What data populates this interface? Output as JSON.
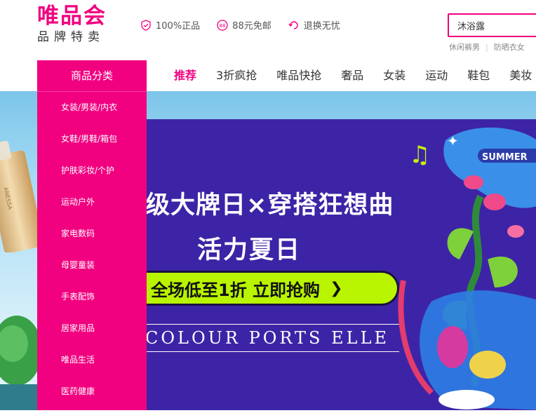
{
  "header": {
    "logo_main": "唯品会",
    "logo_sub": "品牌特卖",
    "promises": [
      {
        "icon": "shield-check-icon",
        "label": "100%正品"
      },
      {
        "icon": "free-shipping-88-icon",
        "label": "88元免邮"
      },
      {
        "icon": "return-arrow-icon",
        "label": "退换无忧"
      }
    ],
    "search": {
      "value": "沐浴露"
    },
    "hot_words": [
      "休闲裤男",
      "防晒衣女"
    ]
  },
  "category": {
    "title": "商品分类",
    "items": [
      "女装/男装/内衣",
      "女鞋/男鞋/箱包",
      "护肤彩妆/个护",
      "运动户外",
      "家电数码",
      "母婴童装",
      "手表配饰",
      "居家用品",
      "唯品生活",
      "医药健康"
    ]
  },
  "nav": {
    "items": [
      "推荐",
      "3折疯抢",
      "唯品快抢",
      "奢品",
      "女装",
      "运动",
      "鞋包",
      "美妆"
    ],
    "active_index": 0
  },
  "banner": {
    "title": "级大牌日×穿搭狂想曲",
    "subtitle": "活力夏日",
    "cta": "全场低至1折 立即抢购",
    "brands": "COLOUR  PORTS  ELLE",
    "badge": "SUMMER",
    "product_text": "ANESSA",
    "colors": {
      "banner_bg": "#3d24a6",
      "cta_bg": "#b9f400",
      "accent": "#f10180"
    }
  }
}
